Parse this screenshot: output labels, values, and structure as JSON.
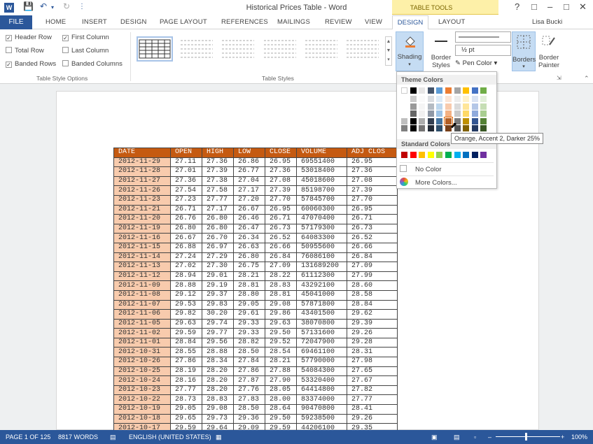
{
  "window": {
    "title": "Historical Prices Table - Word",
    "app_logo": "W",
    "table_tools": "TABLE TOOLS",
    "user": "Lisa Bucki"
  },
  "tabs": [
    "FILE",
    "HOME",
    "INSERT",
    "DESIGN",
    "PAGE LAYOUT",
    "REFERENCES",
    "MAILINGS",
    "REVIEW",
    "VIEW",
    "DESIGN",
    "LAYOUT"
  ],
  "options": {
    "header_row": "Header Row",
    "first_column": "First Column",
    "total_row": "Total Row",
    "last_column": "Last Column",
    "banded_rows": "Banded Rows",
    "banded_columns": "Banded Columns",
    "group": "Table Style Options"
  },
  "styles_group": "Table Styles",
  "buttons": {
    "shading": "Shading",
    "border_styles_1": "Border",
    "border_styles_2": "Styles",
    "pen_weight": "½ pt",
    "pen_color": "Pen Color",
    "borders": "Borders",
    "border_painter_1": "Border",
    "border_painter_2": "Painter"
  },
  "shading_menu": {
    "theme_colors": "Theme Colors",
    "standard_colors": "Standard Colors",
    "no_color": "No Color",
    "more_colors": "More Colors...",
    "tooltip": "Orange, Accent 2, Darker 25%"
  },
  "colors": {
    "accent_blue": "#2b579a",
    "header_orange": "#c55a11",
    "date_fill": "#f8cbad",
    "theme_top": [
      "#ffffff",
      "#000000",
      "#e7e6e6",
      "#44546a",
      "#5b9bd5",
      "#ed7d31",
      "#a5a5a5",
      "#ffc000",
      "#4472c4",
      "#70ad47"
    ],
    "standard": [
      "#c00000",
      "#ff0000",
      "#ffc000",
      "#ffff00",
      "#92d050",
      "#00b050",
      "#00b0f0",
      "#0070c0",
      "#002060",
      "#7030a0"
    ]
  },
  "table": {
    "headers": [
      "DATE",
      "OPEN",
      "HIGH",
      "LOW",
      "CLOSE",
      "VOLUME",
      "ADJ CLOS"
    ],
    "rows": [
      [
        "2012-11-29",
        "27.11",
        "27.36",
        "26.86",
        "26.95",
        "69551400",
        "26.95"
      ],
      [
        "2012-11-28",
        "27.01",
        "27.39",
        "26.77",
        "27.36",
        "53018400",
        "27.36"
      ],
      [
        "2012-11-27",
        "27.36",
        "27.38",
        "27.04",
        "27.08",
        "45018600",
        "27.08"
      ],
      [
        "2012-11-26",
        "27.54",
        "27.58",
        "27.17",
        "27.39",
        "85198700",
        "27.39"
      ],
      [
        "2012-11-23",
        "27.23",
        "27.77",
        "27.20",
        "27.70",
        "57845700",
        "27.70"
      ],
      [
        "2012-11-21",
        "26.71",
        "27.17",
        "26.67",
        "26.95",
        "60060300",
        "26.95"
      ],
      [
        "2012-11-20",
        "26.76",
        "26.80",
        "26.46",
        "26.71",
        "47070400",
        "26.71"
      ],
      [
        "2012-11-19",
        "26.80",
        "26.80",
        "26.47",
        "26.73",
        "57179300",
        "26.73"
      ],
      [
        "2012-11-16",
        "26.67",
        "26.70",
        "26.34",
        "26.52",
        "64083300",
        "26.52"
      ],
      [
        "2012-11-15",
        "26.88",
        "26.97",
        "26.63",
        "26.66",
        "50955600",
        "26.66"
      ],
      [
        "2012-11-14",
        "27.24",
        "27.29",
        "26.80",
        "26.84",
        "76086100",
        "26.84"
      ],
      [
        "2012-11-13",
        "27.02",
        "27.30",
        "26.75",
        "27.09",
        "131689200",
        "27.09"
      ],
      [
        "2012-11-12",
        "28.94",
        "29.01",
        "28.21",
        "28.22",
        "61112300",
        "27.99"
      ],
      [
        "2012-11-09",
        "28.88",
        "29.19",
        "28.81",
        "28.83",
        "43292100",
        "28.60"
      ],
      [
        "2012-11-08",
        "29.12",
        "29.37",
        "28.80",
        "28.81",
        "45041000",
        "28.58"
      ],
      [
        "2012-11-07",
        "29.53",
        "29.83",
        "29.05",
        "29.08",
        "57871800",
        "28.84"
      ],
      [
        "2012-11-06",
        "29.82",
        "30.20",
        "29.61",
        "29.86",
        "43401500",
        "29.62"
      ],
      [
        "2012-11-05",
        "29.63",
        "29.74",
        "29.33",
        "29.63",
        "38070800",
        "29.39"
      ],
      [
        "2012-11-02",
        "29.59",
        "29.77",
        "29.33",
        "29.50",
        "57131600",
        "29.26"
      ],
      [
        "2012-11-01",
        "28.84",
        "29.56",
        "28.82",
        "29.52",
        "72047900",
        "29.28"
      ],
      [
        "2012-10-31",
        "28.55",
        "28.88",
        "28.50",
        "28.54",
        "69461100",
        "28.31"
      ],
      [
        "2012-10-26",
        "27.86",
        "28.34",
        "27.84",
        "28.21",
        "57790000",
        "27.98"
      ],
      [
        "2012-10-25",
        "28.19",
        "28.20",
        "27.86",
        "27.88",
        "54084300",
        "27.65"
      ],
      [
        "2012-10-24",
        "28.16",
        "28.20",
        "27.87",
        "27.90",
        "53320400",
        "27.67"
      ],
      [
        "2012-10-23",
        "27.77",
        "28.20",
        "27.76",
        "28.05",
        "64414800",
        "27.82"
      ],
      [
        "2012-10-22",
        "28.73",
        "28.83",
        "27.83",
        "28.00",
        "83374000",
        "27.77"
      ],
      [
        "2012-10-19",
        "29.05",
        "29.08",
        "28.50",
        "28.64",
        "90470800",
        "28.41"
      ],
      [
        "2012-10-18",
        "29.65",
        "29.73",
        "29.36",
        "29.50",
        "59238500",
        "29.26"
      ],
      [
        "2012-10-17",
        "29.59",
        "29.64",
        "29.09",
        "29.59",
        "44206100",
        "29.35"
      ]
    ]
  },
  "status": {
    "page": "PAGE 1 OF 125",
    "words": "8817 WORDS",
    "language": "ENGLISH (UNITED STATES)",
    "zoom": "100%"
  }
}
